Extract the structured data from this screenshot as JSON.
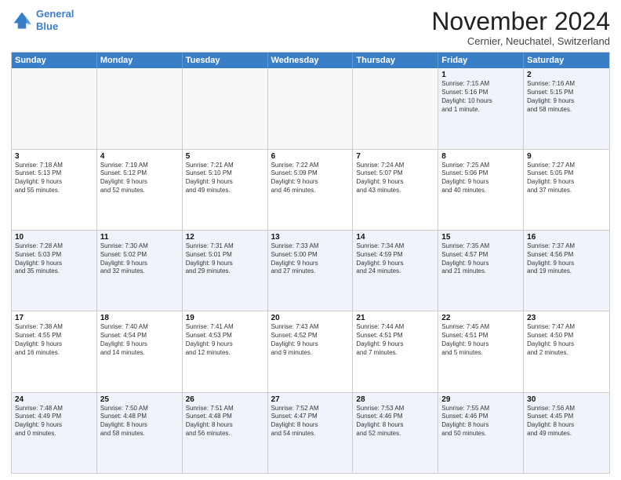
{
  "logo": {
    "line1": "General",
    "line2": "Blue"
  },
  "header": {
    "month": "November 2024",
    "location": "Cernier, Neuchatel, Switzerland"
  },
  "days": [
    "Sunday",
    "Monday",
    "Tuesday",
    "Wednesday",
    "Thursday",
    "Friday",
    "Saturday"
  ],
  "rows": [
    [
      {
        "day": "",
        "info": ""
      },
      {
        "day": "",
        "info": ""
      },
      {
        "day": "",
        "info": ""
      },
      {
        "day": "",
        "info": ""
      },
      {
        "day": "",
        "info": ""
      },
      {
        "day": "1",
        "info": "Sunrise: 7:15 AM\nSunset: 5:16 PM\nDaylight: 10 hours\nand 1 minute."
      },
      {
        "day": "2",
        "info": "Sunrise: 7:16 AM\nSunset: 5:15 PM\nDaylight: 9 hours\nand 58 minutes."
      }
    ],
    [
      {
        "day": "3",
        "info": "Sunrise: 7:18 AM\nSunset: 5:13 PM\nDaylight: 9 hours\nand 55 minutes."
      },
      {
        "day": "4",
        "info": "Sunrise: 7:19 AM\nSunset: 5:12 PM\nDaylight: 9 hours\nand 52 minutes."
      },
      {
        "day": "5",
        "info": "Sunrise: 7:21 AM\nSunset: 5:10 PM\nDaylight: 9 hours\nand 49 minutes."
      },
      {
        "day": "6",
        "info": "Sunrise: 7:22 AM\nSunset: 5:09 PM\nDaylight: 9 hours\nand 46 minutes."
      },
      {
        "day": "7",
        "info": "Sunrise: 7:24 AM\nSunset: 5:07 PM\nDaylight: 9 hours\nand 43 minutes."
      },
      {
        "day": "8",
        "info": "Sunrise: 7:25 AM\nSunset: 5:06 PM\nDaylight: 9 hours\nand 40 minutes."
      },
      {
        "day": "9",
        "info": "Sunrise: 7:27 AM\nSunset: 5:05 PM\nDaylight: 9 hours\nand 37 minutes."
      }
    ],
    [
      {
        "day": "10",
        "info": "Sunrise: 7:28 AM\nSunset: 5:03 PM\nDaylight: 9 hours\nand 35 minutes."
      },
      {
        "day": "11",
        "info": "Sunrise: 7:30 AM\nSunset: 5:02 PM\nDaylight: 9 hours\nand 32 minutes."
      },
      {
        "day": "12",
        "info": "Sunrise: 7:31 AM\nSunset: 5:01 PM\nDaylight: 9 hours\nand 29 minutes."
      },
      {
        "day": "13",
        "info": "Sunrise: 7:33 AM\nSunset: 5:00 PM\nDaylight: 9 hours\nand 27 minutes."
      },
      {
        "day": "14",
        "info": "Sunrise: 7:34 AM\nSunset: 4:59 PM\nDaylight: 9 hours\nand 24 minutes."
      },
      {
        "day": "15",
        "info": "Sunrise: 7:35 AM\nSunset: 4:57 PM\nDaylight: 9 hours\nand 21 minutes."
      },
      {
        "day": "16",
        "info": "Sunrise: 7:37 AM\nSunset: 4:56 PM\nDaylight: 9 hours\nand 19 minutes."
      }
    ],
    [
      {
        "day": "17",
        "info": "Sunrise: 7:38 AM\nSunset: 4:55 PM\nDaylight: 9 hours\nand 16 minutes."
      },
      {
        "day": "18",
        "info": "Sunrise: 7:40 AM\nSunset: 4:54 PM\nDaylight: 9 hours\nand 14 minutes."
      },
      {
        "day": "19",
        "info": "Sunrise: 7:41 AM\nSunset: 4:53 PM\nDaylight: 9 hours\nand 12 minutes."
      },
      {
        "day": "20",
        "info": "Sunrise: 7:43 AM\nSunset: 4:52 PM\nDaylight: 9 hours\nand 9 minutes."
      },
      {
        "day": "21",
        "info": "Sunrise: 7:44 AM\nSunset: 4:51 PM\nDaylight: 9 hours\nand 7 minutes."
      },
      {
        "day": "22",
        "info": "Sunrise: 7:45 AM\nSunset: 4:51 PM\nDaylight: 9 hours\nand 5 minutes."
      },
      {
        "day": "23",
        "info": "Sunrise: 7:47 AM\nSunset: 4:50 PM\nDaylight: 9 hours\nand 2 minutes."
      }
    ],
    [
      {
        "day": "24",
        "info": "Sunrise: 7:48 AM\nSunset: 4:49 PM\nDaylight: 9 hours\nand 0 minutes."
      },
      {
        "day": "25",
        "info": "Sunrise: 7:50 AM\nSunset: 4:48 PM\nDaylight: 8 hours\nand 58 minutes."
      },
      {
        "day": "26",
        "info": "Sunrise: 7:51 AM\nSunset: 4:48 PM\nDaylight: 8 hours\nand 56 minutes."
      },
      {
        "day": "27",
        "info": "Sunrise: 7:52 AM\nSunset: 4:47 PM\nDaylight: 8 hours\nand 54 minutes."
      },
      {
        "day": "28",
        "info": "Sunrise: 7:53 AM\nSunset: 4:46 PM\nDaylight: 8 hours\nand 52 minutes."
      },
      {
        "day": "29",
        "info": "Sunrise: 7:55 AM\nSunset: 4:46 PM\nDaylight: 8 hours\nand 50 minutes."
      },
      {
        "day": "30",
        "info": "Sunrise: 7:56 AM\nSunset: 4:45 PM\nDaylight: 8 hours\nand 49 minutes."
      }
    ]
  ]
}
